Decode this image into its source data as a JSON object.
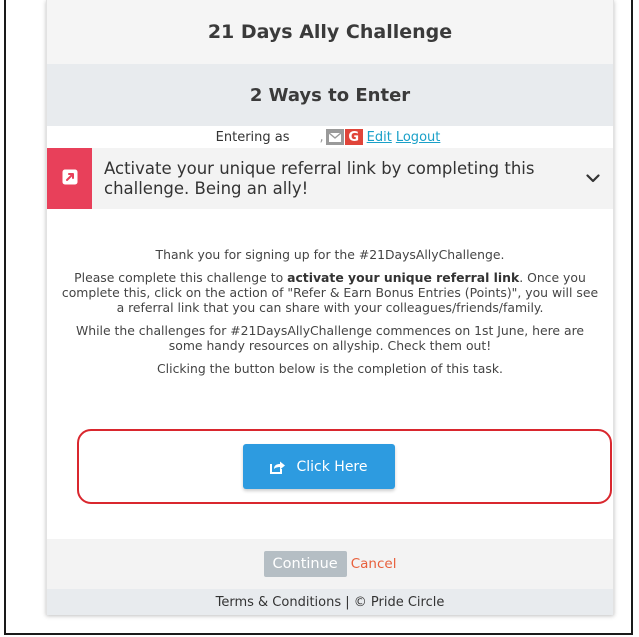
{
  "header": {
    "title": "21 Days Ally Challenge",
    "subtitle": "2 Ways to Enter"
  },
  "entering": {
    "label": "Entering as",
    "separator": ",",
    "edit_label": "Edit",
    "logout_label": "Logout"
  },
  "task": {
    "text": "Activate your unique referral link by completing this challenge. Being an ally!"
  },
  "body": {
    "para1": "Thank you for signing up for the #21DaysAllyChallenge.",
    "para2_pre": "Please complete this challenge to ",
    "para2_bold": "activate your unique referral link",
    "para2_post": ". Once you complete this, click on the action of \"Refer & Earn Bonus Entries (Points)\", you will see a referral link that you can share with your colleagues/friends/family.",
    "para3": "While the challenges for #21DaysAllyChallenge commences on 1st June, here are some handy resources on allyship. Check them out!",
    "para4": "Clicking the button below is the completion of this task."
  },
  "action": {
    "click_label": "Click Here"
  },
  "footer": {
    "continue_label": "Continue",
    "cancel_label": "Cancel",
    "terms_text": "Terms & Conditions | © Pride Circle"
  },
  "colors": {
    "accent_blue": "#2d9be0",
    "task_red": "#e8405a",
    "highlight_red": "#d9272e",
    "cancel_orange": "#e8603c",
    "link_blue": "#1aa0c8"
  },
  "icons": {
    "task": "external-link-icon",
    "chevron": "chevron-down-icon",
    "mail": "mail-icon",
    "google": "google-icon",
    "share": "share-icon"
  }
}
